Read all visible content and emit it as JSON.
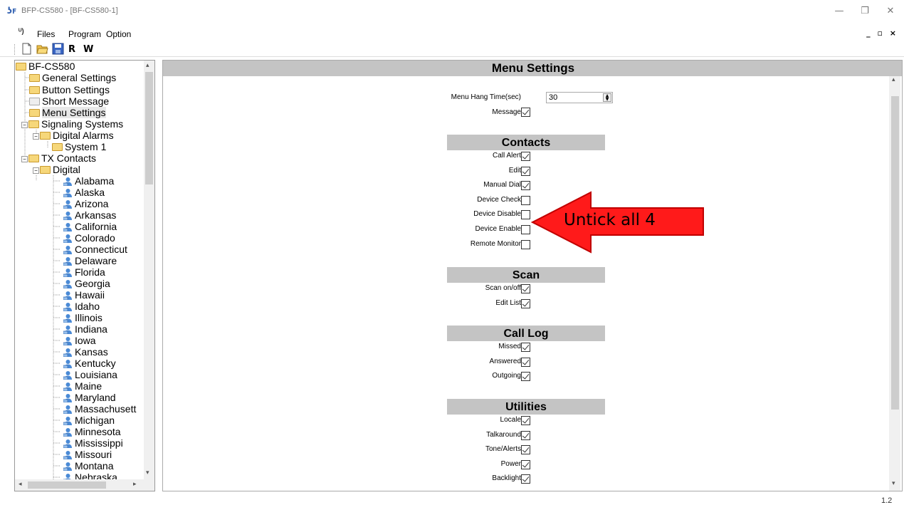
{
  "window": {
    "title": "BFP-CS580 - [BF-CS580-1]",
    "minimize": "—",
    "restore": "❐",
    "close": "✕"
  },
  "menubar": {
    "items": [
      "Files",
      "Program",
      "Option"
    ],
    "mdi_controls": "_ ▫ ×"
  },
  "toolbar": {
    "read_label": "R",
    "write_label": "W"
  },
  "tree": {
    "root": "BF-CS580",
    "general_settings": "General Settings",
    "button_settings": "Button Settings",
    "short_message": "Short Message",
    "menu_settings": "Menu Settings",
    "signaling_systems": "Signaling Systems",
    "digital_alarms": "Digital Alarms",
    "system1": "System 1",
    "tx_contacts": "TX Contacts",
    "digital": "Digital",
    "contacts": [
      "Alabama",
      "Alaska",
      "Arizona",
      "Arkansas",
      "California",
      "Colorado",
      "Connecticut",
      "Delaware",
      "Florida",
      "Georgia",
      "Hawaii",
      "Idaho",
      "Illinois",
      "Indiana",
      "Iowa",
      "Kansas",
      "Kentucky",
      "Louisiana",
      "Maine",
      "Maryland",
      "Massachusett",
      "Michigan",
      "Minnesota",
      "Mississippi",
      "Missouri",
      "Montana",
      "Nebraska"
    ]
  },
  "main": {
    "header": "Menu Settings",
    "menu_hang_time_label": "Menu Hang Time(sec)",
    "menu_hang_time_value": "30",
    "message_label": "Message",
    "message_checked": true,
    "sections": [
      {
        "title": "Contacts",
        "items": [
          {
            "label": "Call Alert",
            "checked": true
          },
          {
            "label": "Edit",
            "checked": true
          },
          {
            "label": "Manual Dial",
            "checked": true
          },
          {
            "label": "Device Check",
            "checked": false
          },
          {
            "label": "Device Disable",
            "checked": false
          },
          {
            "label": "Device Enable",
            "checked": false
          },
          {
            "label": "Remote Monitor",
            "checked": false
          }
        ]
      },
      {
        "title": "Scan",
        "items": [
          {
            "label": "Scan on/off",
            "checked": true
          },
          {
            "label": "Edit List",
            "checked": true
          }
        ]
      },
      {
        "title": "Call Log",
        "items": [
          {
            "label": "Missed",
            "checked": true
          },
          {
            "label": "Answered",
            "checked": true
          },
          {
            "label": "Outgoing",
            "checked": true
          }
        ]
      },
      {
        "title": "Utilities",
        "items": [
          {
            "label": "Locale",
            "checked": true
          },
          {
            "label": "Talkaround",
            "checked": true
          },
          {
            "label": "Tone/Alerts",
            "checked": true
          },
          {
            "label": "Power",
            "checked": true
          },
          {
            "label": "Backlight",
            "checked": true
          }
        ]
      }
    ]
  },
  "annotation": {
    "text": "Untick all 4",
    "color": "#ff1a1a"
  },
  "status": {
    "version": "1.2"
  },
  "colors": {
    "section_bg": "#c4c4c4",
    "folder": "#f6d77a",
    "contact_icon": "#4a8ad6"
  }
}
